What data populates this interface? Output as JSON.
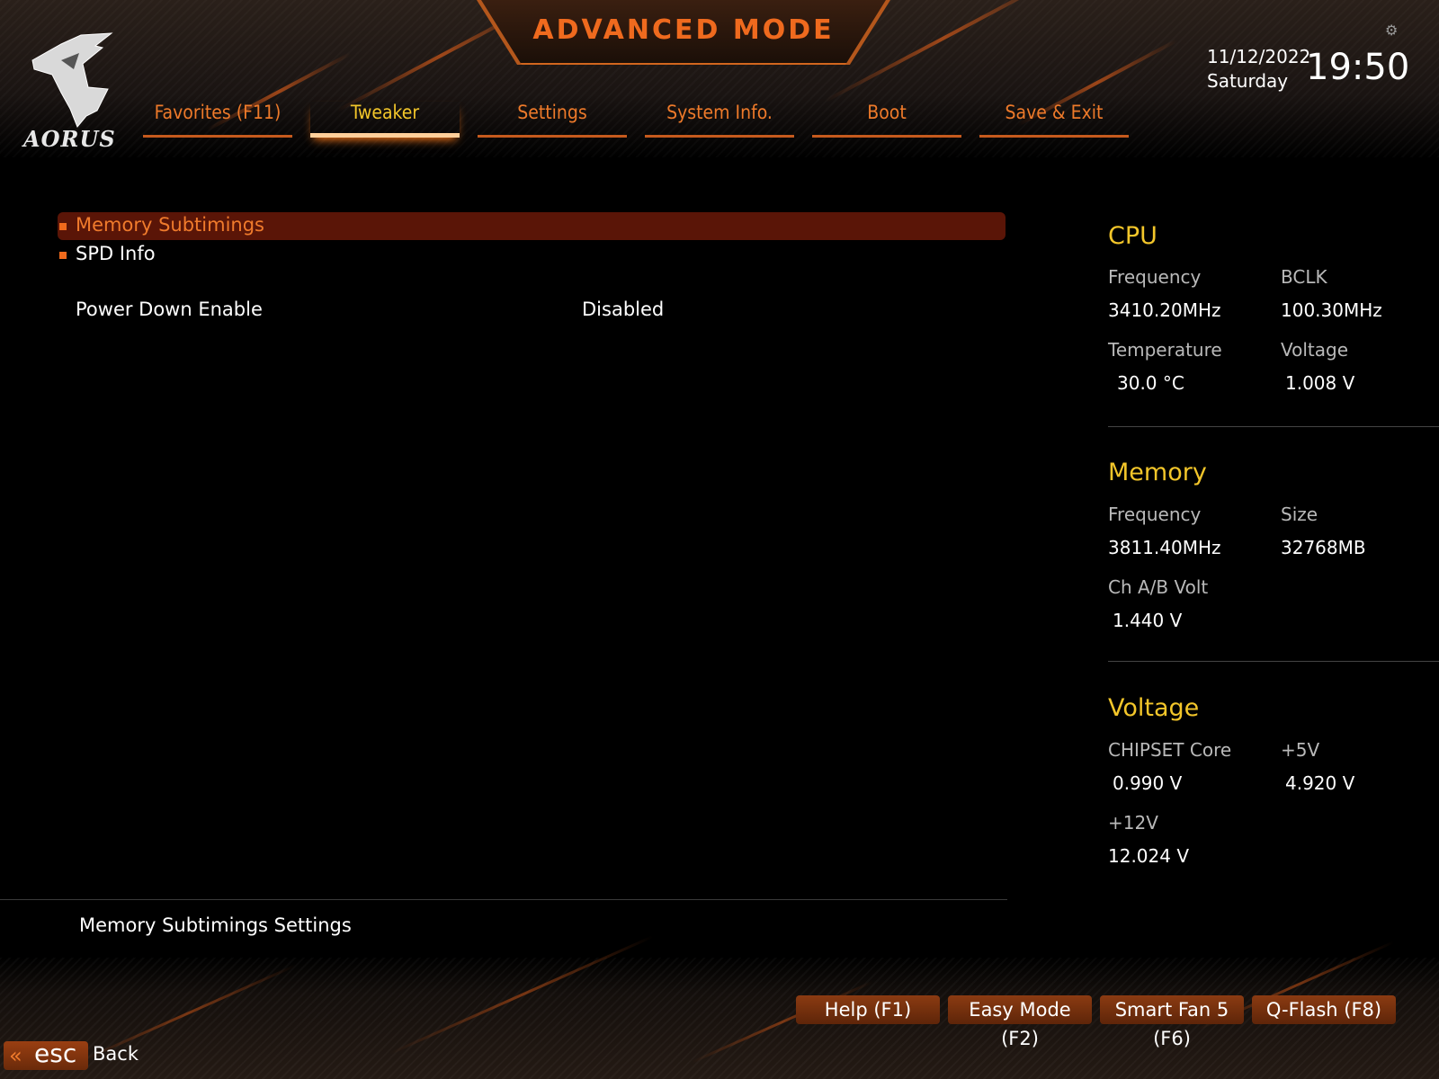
{
  "header": {
    "mode_title": "ADVANCED MODE",
    "logo_text": "AORUS",
    "date": "11/12/2022",
    "weekday": "Saturday",
    "time": "19:50",
    "accent_color": "#f06a1c",
    "active_tab_color": "#f3c62a"
  },
  "tabs": [
    {
      "label": "Favorites (F11)"
    },
    {
      "label": "Tweaker"
    },
    {
      "label": "Settings"
    },
    {
      "label": "System Info."
    },
    {
      "label": "Boot"
    },
    {
      "label": "Save & Exit"
    }
  ],
  "menu": {
    "items": [
      {
        "label": "Memory Subtimings"
      },
      {
        "label": "SPD Info"
      }
    ],
    "setting": {
      "label": "Power Down Enable",
      "value": "Disabled"
    },
    "help_text": "Memory Subtimings Settings"
  },
  "panel": {
    "cpu": {
      "title": "CPU",
      "frequency_label": "Frequency",
      "frequency": "3410.20MHz",
      "bclk_label": "BCLK",
      "bclk": "100.30MHz",
      "temperature_label": "Temperature",
      "temperature": "30.0 °C",
      "voltage_label": "Voltage",
      "voltage": "1.008 V"
    },
    "memory": {
      "title": "Memory",
      "frequency_label": "Frequency",
      "frequency": "3811.40MHz",
      "size_label": "Size",
      "size": "32768MB",
      "volt_label": "Ch A/B Volt",
      "volt": "1.440 V"
    },
    "voltage": {
      "title": "Voltage",
      "chipset_label": "CHIPSET Core",
      "chipset": "0.990 V",
      "v5_label": "+5V",
      "v5": "4.920 V",
      "v12_label": "+12V",
      "v12": "12.024 V"
    }
  },
  "footer": {
    "buttons": [
      {
        "label": "Help (F1)"
      },
      {
        "label": "Easy Mode (F2)"
      },
      {
        "label": "Smart Fan 5 (F6)"
      },
      {
        "label": "Q-Flash (F8)"
      }
    ],
    "esc_key": "esc",
    "back_label": "Back"
  }
}
